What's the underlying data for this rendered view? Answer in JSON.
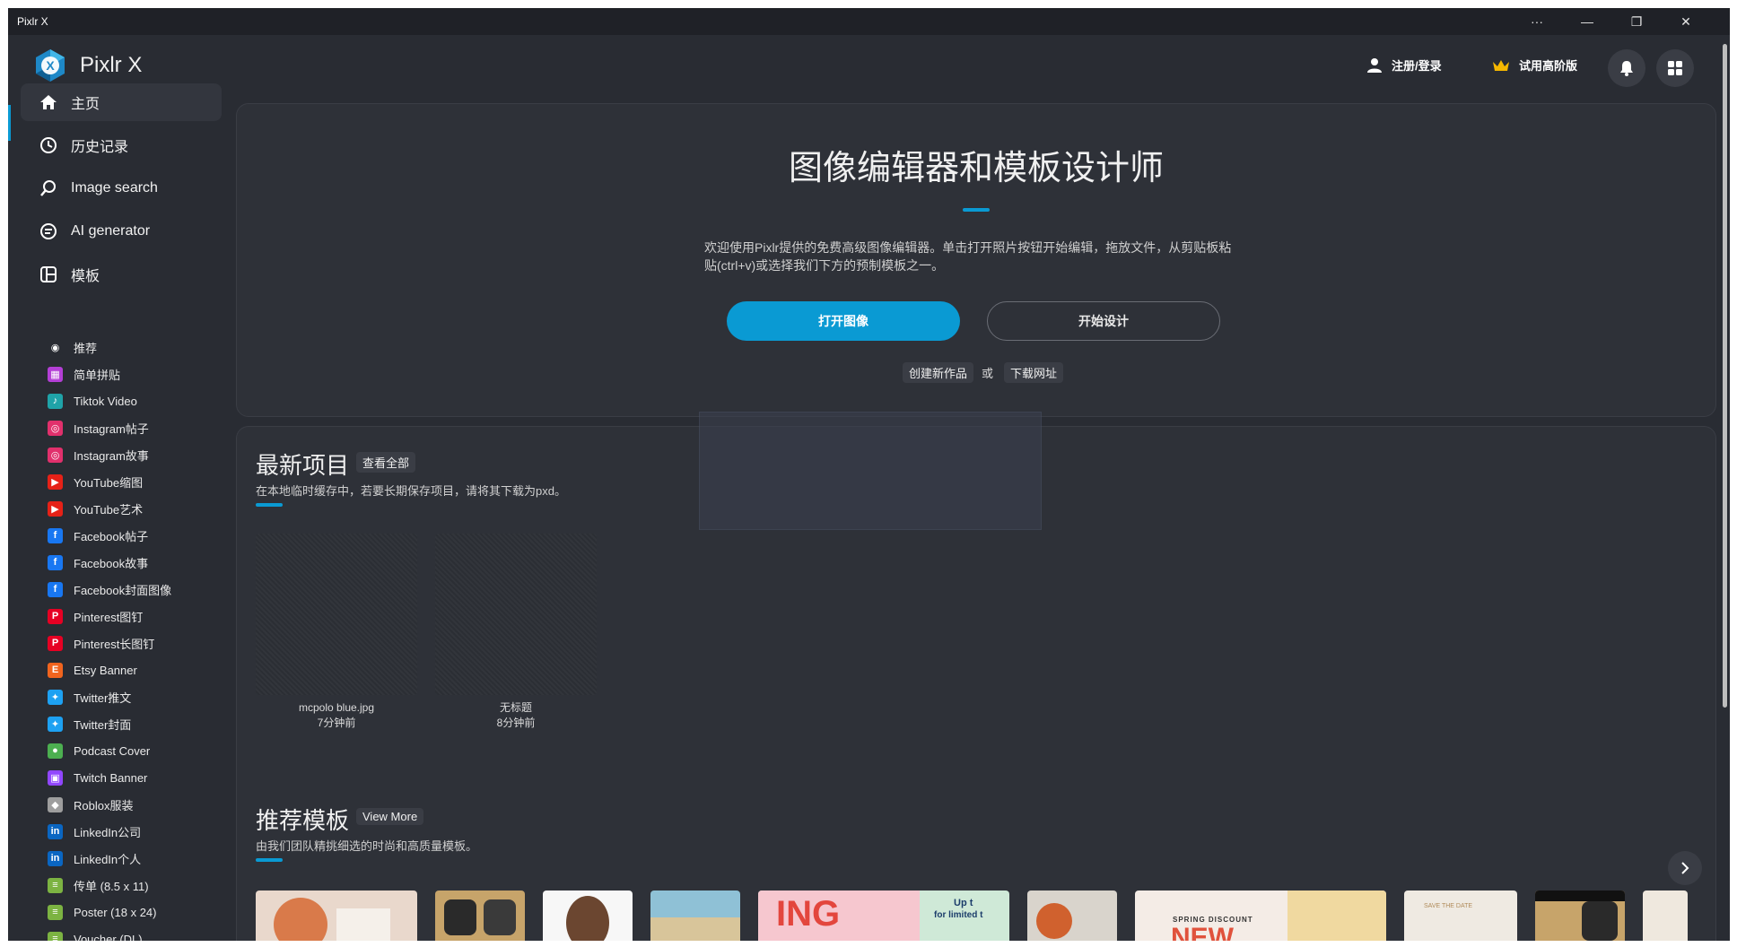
{
  "window": {
    "title": "Pixlr X",
    "more": "···",
    "minimize": "—",
    "restore": "❐",
    "close": "✕"
  },
  "header": {
    "app_name": "Pixlr X",
    "login": "注册/登录",
    "premium": "试用高阶版"
  },
  "sidebar": {
    "nav": [
      {
        "label": "主页",
        "icon": "home-icon"
      },
      {
        "label": "历史记录",
        "icon": "clock-icon"
      },
      {
        "label": "Image search",
        "icon": "search-icon"
      },
      {
        "label": "AI generator",
        "icon": "ai-icon"
      },
      {
        "label": "模板",
        "icon": "template-icon"
      }
    ],
    "templates": [
      {
        "label": "推荐",
        "icon": "eye-icon",
        "color": "#292c33"
      },
      {
        "label": "简单拼贴",
        "icon": "collage-icon",
        "color": "#b43fd6"
      },
      {
        "label": "Tiktok Video",
        "icon": "tiktok-icon",
        "color": "#1fa3a8"
      },
      {
        "label": "Instagram帖子",
        "icon": "instagram-icon",
        "color": "#e1306c"
      },
      {
        "label": "Instagram故事",
        "icon": "instagram-icon",
        "color": "#e1306c"
      },
      {
        "label": "YouTube缩图",
        "icon": "youtube-icon",
        "color": "#e62117"
      },
      {
        "label": "YouTube艺术",
        "icon": "youtube-icon",
        "color": "#e62117"
      },
      {
        "label": "Facebook帖子",
        "icon": "facebook-icon",
        "color": "#1877f2"
      },
      {
        "label": "Facebook故事",
        "icon": "facebook-icon",
        "color": "#1877f2"
      },
      {
        "label": "Facebook封面图像",
        "icon": "facebook-icon",
        "color": "#1877f2"
      },
      {
        "label": "Pinterest图钉",
        "icon": "pinterest-icon",
        "color": "#e60023"
      },
      {
        "label": "Pinterest长图钉",
        "icon": "pinterest-icon",
        "color": "#e60023"
      },
      {
        "label": "Etsy Banner",
        "icon": "etsy-icon",
        "color": "#f1641e"
      },
      {
        "label": "Twitter推文",
        "icon": "twitter-icon",
        "color": "#1da1f2"
      },
      {
        "label": "Twitter封面",
        "icon": "twitter-icon",
        "color": "#1da1f2"
      },
      {
        "label": "Podcast Cover",
        "icon": "podcast-icon",
        "color": "#4caf50"
      },
      {
        "label": "Twitch Banner",
        "icon": "twitch-icon",
        "color": "#9146ff"
      },
      {
        "label": "Roblox服装",
        "icon": "roblox-icon",
        "color": "#9e9e9e"
      },
      {
        "label": "LinkedIn公司",
        "icon": "linkedin-icon",
        "color": "#0a66c2"
      },
      {
        "label": "LinkedIn个人",
        "icon": "linkedin-icon",
        "color": "#0a66c2"
      },
      {
        "label": "传单 (8.5 x 11)",
        "icon": "flyer-icon",
        "color": "#7cb342"
      },
      {
        "label": "Poster (18 x 24)",
        "icon": "poster-icon",
        "color": "#7cb342"
      },
      {
        "label": "Voucher (DL)",
        "icon": "voucher-icon",
        "color": "#7cb342"
      }
    ]
  },
  "hero": {
    "title": "图像编辑器和模板设计师",
    "description": "欢迎使用Pixlr提供的免费高级图像编辑器。单击打开照片按钮开始编辑，拖放文件，从剪贴板粘贴(ctrl+v)或选择我们下方的预制模板之一。",
    "open_button": "打开图像",
    "design_button": "开始设计",
    "create_new": "创建新作品",
    "or": "或",
    "download_url": "下载网址"
  },
  "recent": {
    "title": "最新项目",
    "view_all": "查看全部",
    "subtitle": "在本地临时缓存中，若要长期保存项目，请将其下载为pxd。",
    "items": [
      {
        "name": "mcpolo blue.jpg",
        "time": "7分钟前"
      },
      {
        "name": "无标题",
        "time": "8分钟前"
      }
    ]
  },
  "recommended": {
    "title": "推荐模板",
    "view_more": "View More",
    "subtitle": "由我们团队精挑细选的时尚和高质量模板。",
    "thumb_texts": [
      "ING",
      "Up t",
      "for limited t",
      "SPRING DISCOUNT",
      "NEW",
      "SAVE THE DATE"
    ]
  },
  "accent_color": "#0a9ad3"
}
